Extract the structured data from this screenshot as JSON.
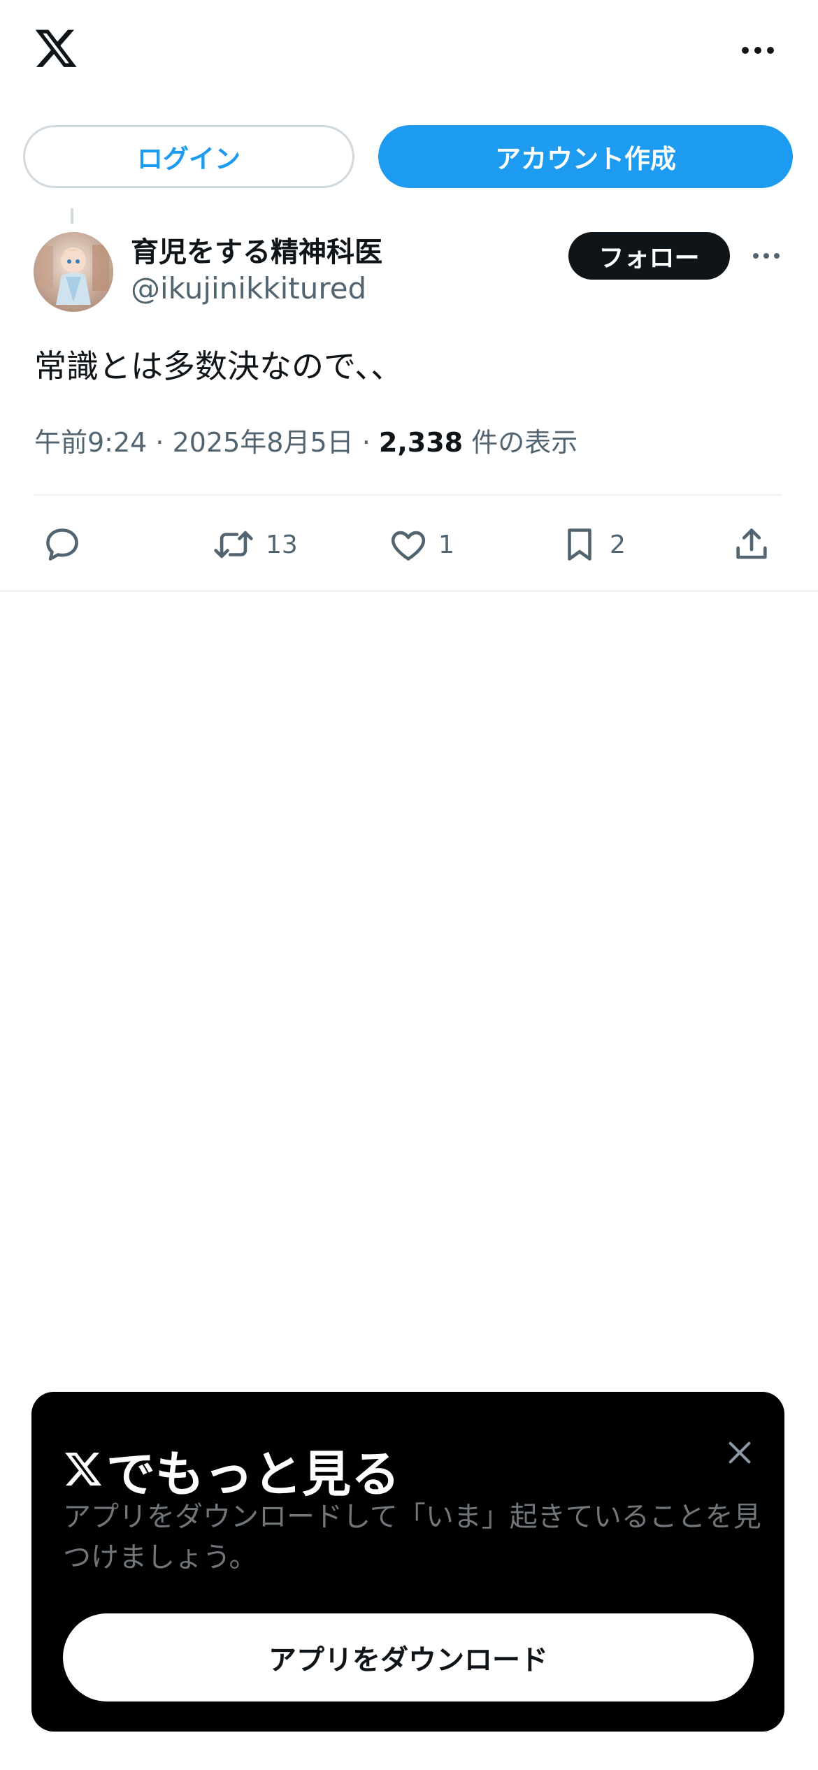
{
  "header": {
    "logo_icon": "x-logo-icon",
    "more_icon": "more-horizontal-icon"
  },
  "auth": {
    "login_label": "ログイン",
    "signup_label": "アカウント作成"
  },
  "tweet": {
    "author_name": "育児をする精神科医",
    "author_handle": "@ikujinikkitured",
    "follow_label": "フォロー",
    "text": "常識とは多数決なので、、",
    "time": "午前9:24",
    "separator": " · ",
    "date": "2025年8月5日",
    "views_count": "2,338",
    "views_label": " 件の表示",
    "actions": {
      "reply_count": "",
      "retweet_count": "13",
      "like_count": "1",
      "bookmark_count": "2"
    }
  },
  "promo": {
    "title": "でもっと見る",
    "description": "アプリをダウンロードして「いま」起きていることを見つけましょう。",
    "button_label": "アプリをダウンロード"
  },
  "colors": {
    "accent": "#1d9bf0",
    "text_primary": "#0f1419",
    "text_secondary": "#536471",
    "promo_bg": "#000000"
  }
}
